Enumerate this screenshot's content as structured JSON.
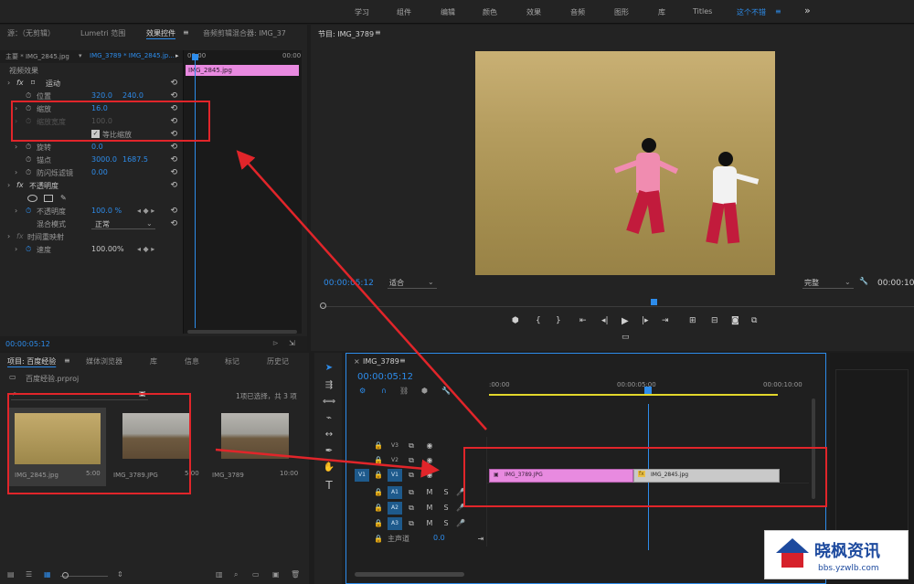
{
  "top_nav": {
    "items": [
      "学习",
      "组件",
      "编辑",
      "颜色",
      "效果",
      "音频",
      "图形",
      "库",
      "Titles",
      "这个不错"
    ],
    "active": "这个不错",
    "menu_icon": "hamburger-icon",
    "more_icon": "double-chevron-right-icon"
  },
  "effect_panel": {
    "tabs": [
      "源：（无剪辑）",
      "Lumetri 范围",
      "效果控件",
      "音频剪辑混合器: IMG_37"
    ],
    "active_tab": "效果控件",
    "master_label": "主要 * IMG_2845.jpg",
    "clip_dropdown": "IMG_3789 * IMG_2845.jp...",
    "section": "视频效果",
    "rows": {
      "motion": "运动",
      "position_label": "位置",
      "position_x": "320.0",
      "position_y": "240.0",
      "scale_label": "缩放",
      "scale_value": "16.0",
      "scale_width_label": "缩放宽度",
      "scale_width_value": "100.0",
      "uniform_label": "等比缩放",
      "rotation_label": "旋转",
      "rotation_value": "0.0",
      "anchor_label": "锚点",
      "anchor_x": "3000.0",
      "anchor_y": "1687.5",
      "flicker_label": "防闪烁滤镜",
      "flicker_value": "0.00",
      "opacity_section": "不透明度",
      "opacity_label": "不透明度",
      "opacity_value": "100.0 %",
      "blend_label": "混合模式",
      "blend_value": "正常",
      "time_remap": "时间重映射",
      "speed_label": "速度",
      "speed_value": "100.00%"
    },
    "mini_timeline": {
      "tick_start": "00:00",
      "tick_end": "00:00",
      "clip_label": "IMG_2845.jpg"
    },
    "timecode": "00:00:05:12"
  },
  "program_monitor": {
    "title": "节目: IMG_3789",
    "timecode": "00:00:05:12",
    "fit": "适合",
    "quality": "完整",
    "end_timecode": "00:00:10:"
  },
  "project_panel": {
    "tabs": [
      "项目: 百度经验",
      "媒体浏览器",
      "库",
      "信息",
      "标记",
      "历史记"
    ],
    "active_tab": "项目: 百度经验",
    "project_file": "百度经验.prproj",
    "selection_status": "1项已选择，共 3 项",
    "items": [
      {
        "name": "IMG_2845.jpg",
        "duration": "5:00"
      },
      {
        "name": "IMG_3789.JPG",
        "duration": "5:00"
      },
      {
        "name": "IMG_3789",
        "duration": "10:00"
      }
    ]
  },
  "timeline": {
    "tab": "IMG_3789",
    "timecode": "00:00:05:12",
    "ruler": [
      ":00:00",
      "00:00:05:00",
      "00:00:10:00"
    ],
    "video_tracks": [
      "V3",
      "V2",
      "V1"
    ],
    "audio_tracks": [
      "A1",
      "A2",
      "A3"
    ],
    "source_patch": "V1",
    "master_label": "主声道",
    "master_value": "0.0",
    "clips": [
      {
        "name": "IMG_3789.JPG",
        "color": "#e88ae0"
      },
      {
        "name": "IMG_2845.jpg",
        "color": "#c9c9c9"
      }
    ],
    "fx_badge": "fx"
  },
  "watermark": {
    "title": "晓枫资讯",
    "url": "bbs.yzwlb.com"
  },
  "colors": {
    "accent": "#2d8ceb",
    "annotation": "#e1252a",
    "clip_pink": "#e88ae0",
    "clip_gray": "#c9c9c9"
  }
}
